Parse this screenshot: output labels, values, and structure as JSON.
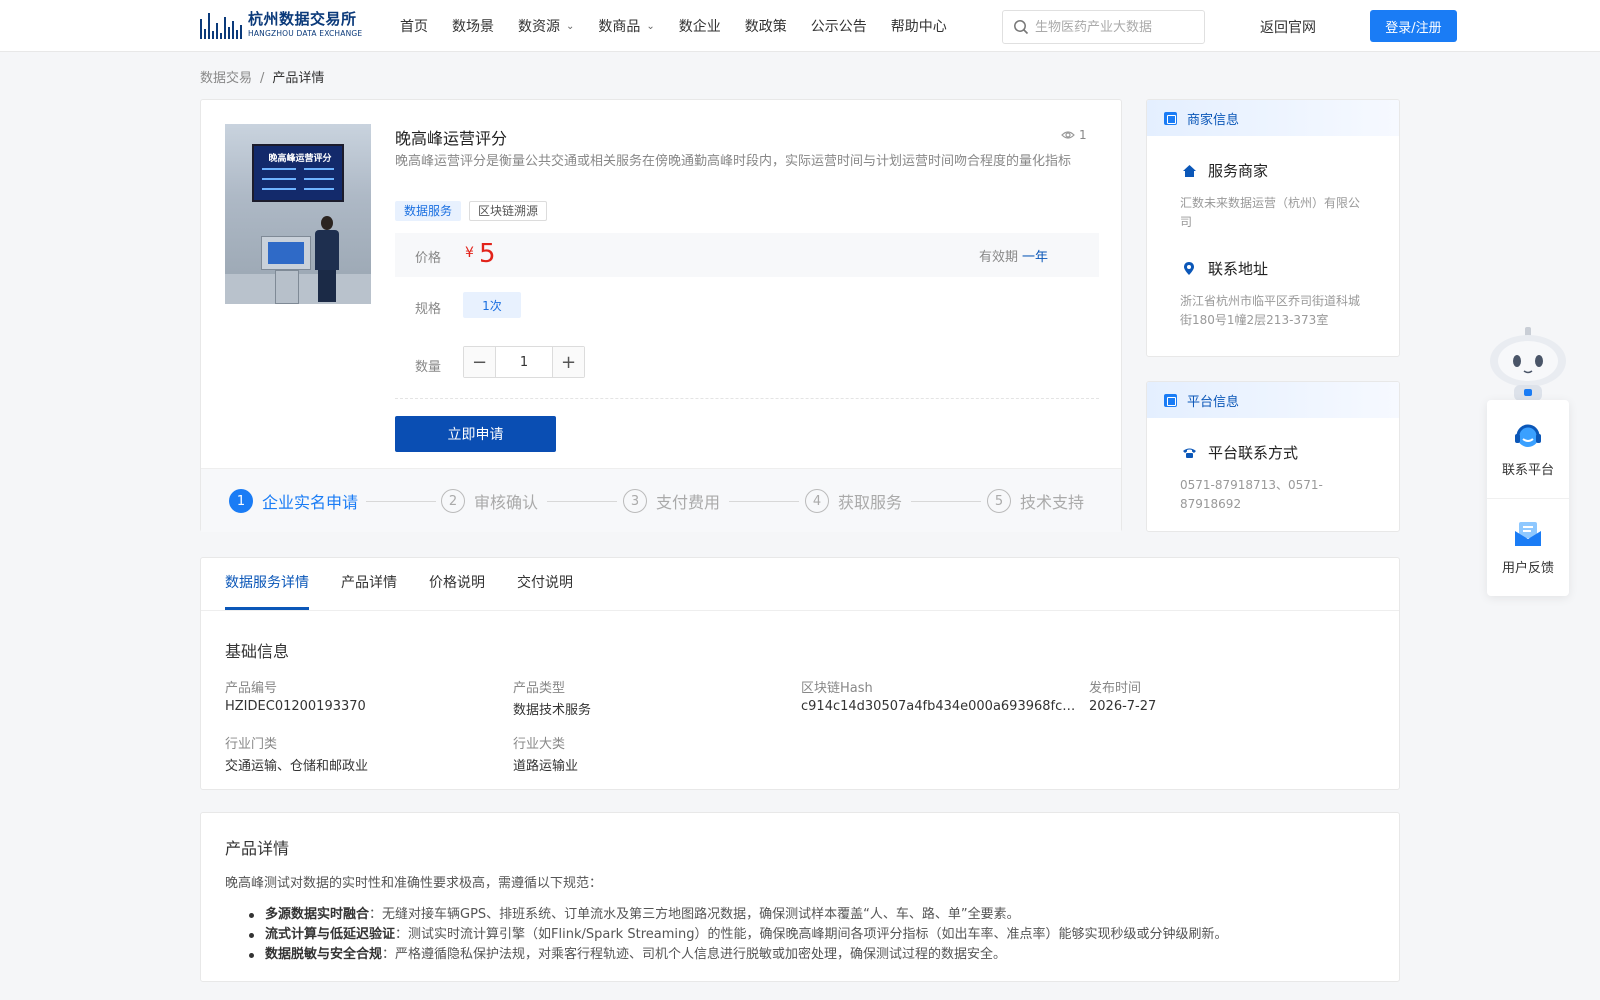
{
  "header": {
    "logo_cn": "杭州数据交易所",
    "logo_en": "HANGZHOU DATA EXCHANGE",
    "nav": [
      {
        "label": "首页",
        "dropdown": false
      },
      {
        "label": "数场景",
        "dropdown": false
      },
      {
        "label": "数资源",
        "dropdown": true
      },
      {
        "label": "数商品",
        "dropdown": true
      },
      {
        "label": "数企业",
        "dropdown": false
      },
      {
        "label": "数政策",
        "dropdown": false
      },
      {
        "label": "公示公告",
        "dropdown": false
      },
      {
        "label": "帮助中心",
        "dropdown": false
      }
    ],
    "search_placeholder": "生物医药产业大数据",
    "back_label": "返回官网",
    "login_label": "登录/注册"
  },
  "breadcrumb": {
    "root": "数据交易",
    "separator": "/",
    "current": "产品详情"
  },
  "product": {
    "title": "晚高峰运营评分",
    "views": "1",
    "description": "晚高峰运营评分是衡量公共交通或相关服务在傍晚通勤高峰时段内，实际运营时间与计划运营时间吻合程度的量化指标",
    "tags": [
      "数据服务",
      "区块链溯源"
    ],
    "image_caption": "晚高峰运营评分",
    "price_label": "价格",
    "currency": "¥",
    "price": "5",
    "validity_label": "有效期",
    "validity_value": "一年",
    "spec_label": "规格",
    "spec_option": "1次",
    "quantity_label": "数量",
    "quantity": "1",
    "apply_label": "立即申请"
  },
  "steps": [
    {
      "num": "1",
      "label": "企业实名申请",
      "active": true
    },
    {
      "num": "2",
      "label": "审核确认",
      "active": false
    },
    {
      "num": "3",
      "label": "支付费用",
      "active": false
    },
    {
      "num": "4",
      "label": "获取服务",
      "active": false
    },
    {
      "num": "5",
      "label": "技术支持",
      "active": false
    }
  ],
  "merchant": {
    "header": "商家信息",
    "service_label": "服务商家",
    "service_value": "汇数未来数据运营（杭州）有限公司",
    "address_label": "联系地址",
    "address_value": "浙江省杭州市临平区乔司街道科城街180号1幢2层213-373室"
  },
  "platform": {
    "header": "平台信息",
    "contact_label": "平台联系方式",
    "contact_value": "0571-87918713、0571-87918692"
  },
  "tabs": [
    "数据服务详情",
    "产品详情",
    "价格说明",
    "交付说明"
  ],
  "basic_info": {
    "title": "基础信息",
    "fields": [
      {
        "label": "产品编号",
        "value": "HZIDEC01200193370"
      },
      {
        "label": "产品类型",
        "value": "数据技术服务"
      },
      {
        "label": "区块链Hash",
        "value": "c914c14d30507a4fb434e000a693968fcdd…"
      },
      {
        "label": "发布时间",
        "value": "2026-7-27"
      },
      {
        "label": "行业门类",
        "value": "交通运输、仓储和邮政业"
      },
      {
        "label": "行业大类",
        "value": "道路运输业"
      }
    ]
  },
  "details": {
    "title": "产品详情",
    "intro": "晚高峰测试对数据的实时性和准确性要求极高，需遵循以下规范：",
    "items": [
      {
        "bold": "多源数据实时融合",
        "text": "：无缝对接车辆GPS、排班系统、订单流水及第三方地图路况数据，确保测试样本覆盖“人、车、路、单”全要素。"
      },
      {
        "bold": "流式计算与低延迟验证",
        "text": "：测试实时流计算引擎（如Flink/Spark Streaming）的性能，确保晚高峰期间各项评分指标（如出车率、准点率）能够实现秒级或分钟级刷新。"
      },
      {
        "bold": "数据脱敏与安全合规",
        "text": "：严格遵循隐私保护法规，对乘客行程轨迹、司机个人信息进行脱敏或加密处理，确保测试过程的数据安全。"
      }
    ]
  },
  "float": {
    "contact": "联系平台",
    "feedback": "用户反馈"
  },
  "colors": {
    "brand": "#0b57b8",
    "accent": "#1a7cf5",
    "price": "#e2231a"
  }
}
